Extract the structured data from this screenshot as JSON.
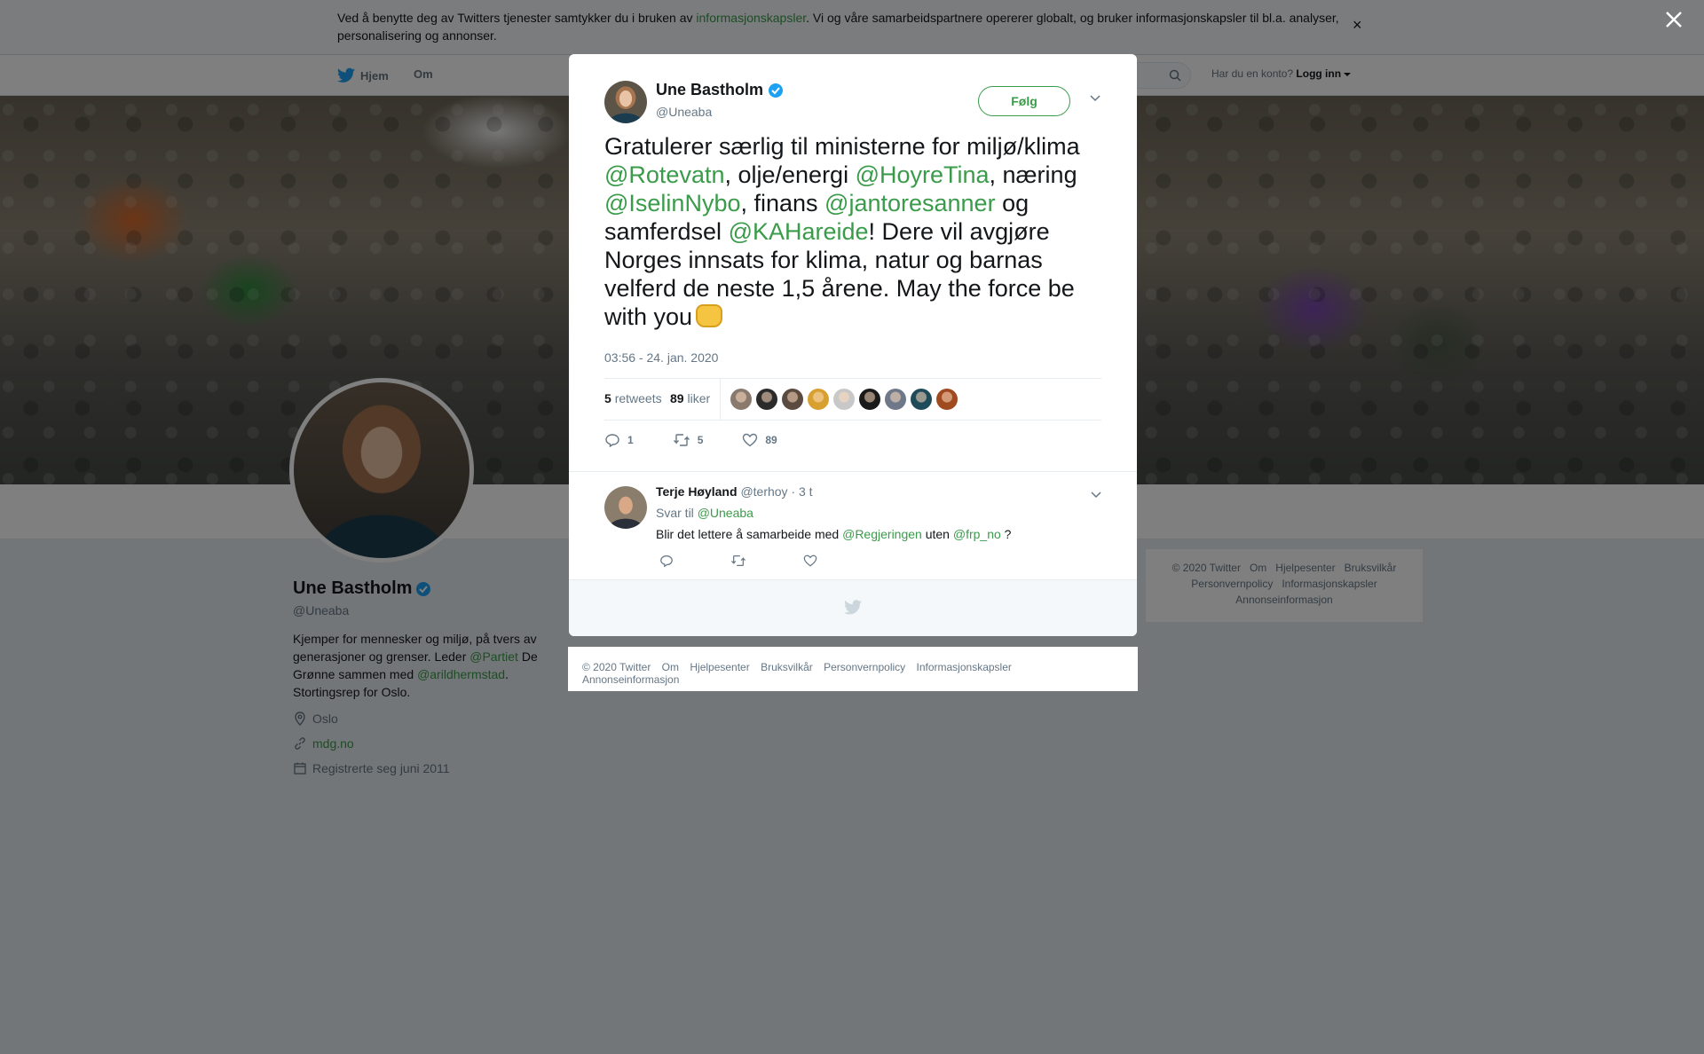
{
  "cookie": {
    "text_before": "Ved å benytte deg av Twitters tjenester samtykker du i bruken av ",
    "link": "informasjonskapsler",
    "text_after": ". Vi og våre samarbeidspartnere opererer globalt, og bruker informasjonskapsler til bl.a. analyser, personalisering og annonser.",
    "close": "×"
  },
  "nav": {
    "home": "Hjem",
    "about": "Om",
    "have_account": "Har du en konto?",
    "login": "Logg inn"
  },
  "profile": {
    "name": "Une Bastholm",
    "handle": "@Uneaba",
    "bio_1": "Kjemper for mennesker og miljø, på tvers av generasjoner og grenser. Leder ",
    "bio_mention_1": "@Partiet",
    "bio_2": " De Grønne sammen med ",
    "bio_mention_2": "@arildhermstad",
    "bio_3": ". Stortingsrep for Oslo.",
    "location": "Oslo",
    "website": "mdg.no",
    "joined": "Registrerte seg juni 2011"
  },
  "sidebar_footer": {
    "items": [
      "© 2020 Twitter",
      "Om",
      "Hjelpesenter",
      "Bruksvilkår",
      "Personvernpolicy",
      "Informasjonskapsler",
      "Annonseinformasjon"
    ]
  },
  "tweet": {
    "author_name": "Une Bastholm",
    "author_handle": "@Uneaba",
    "follow": "Følg",
    "t1": "Gratulerer særlig til ministerne for miljø/klima ",
    "m1": "@Rotevatn",
    "t2": ", olje/energi ",
    "m2": "@HoyreTina",
    "t3": ", næring ",
    "m3": "@IselinNybo",
    "t4": ", finans ",
    "m4": "@jantoresanner",
    "t5": "  og samferdsel ",
    "m5": "@KAHareide",
    "t6": "! Dere vil avgjøre Norges innsats for klima, natur og barnas velferd de neste 1,5 årene. May the force be with you",
    "time": "03:56 - 24. jan. 2020",
    "retweets_count": "5",
    "retweets_label": "retweets",
    "likes_count": "89",
    "likes_label": "liker",
    "reply_count": "1",
    "retweet_count": "5",
    "like_count": "89",
    "liker_colors": [
      "#8a7a6e",
      "#2b2b2b",
      "#5a4a40",
      "#d8a030",
      "#c8c8c8",
      "#1a1a1a",
      "#6e7888",
      "#1f4a5a",
      "#a04a20"
    ]
  },
  "reply": {
    "name": "Terje Høyland",
    "handle": "@terhoy",
    "time": "· 3 t",
    "reply_to_label": "Svar til",
    "reply_to": "@Uneaba",
    "text_1": "Blir det lettere å samarbeide med ",
    "mention_1": "@Regjeringen",
    "text_2": " uten ",
    "mention_2": "@frp_no",
    "text_3": " ?"
  },
  "page_footer": {
    "items": [
      "© 2020 Twitter",
      "Om",
      "Hjelpesenter",
      "Bruksvilkår",
      "Personvernpolicy",
      "Informasjonskapsler",
      "Annonseinformasjon"
    ]
  },
  "colors": {
    "accent": "#3a9b4a",
    "verified": "#1da1f2",
    "overlay": "rgba(0,0,0,0.5)"
  }
}
